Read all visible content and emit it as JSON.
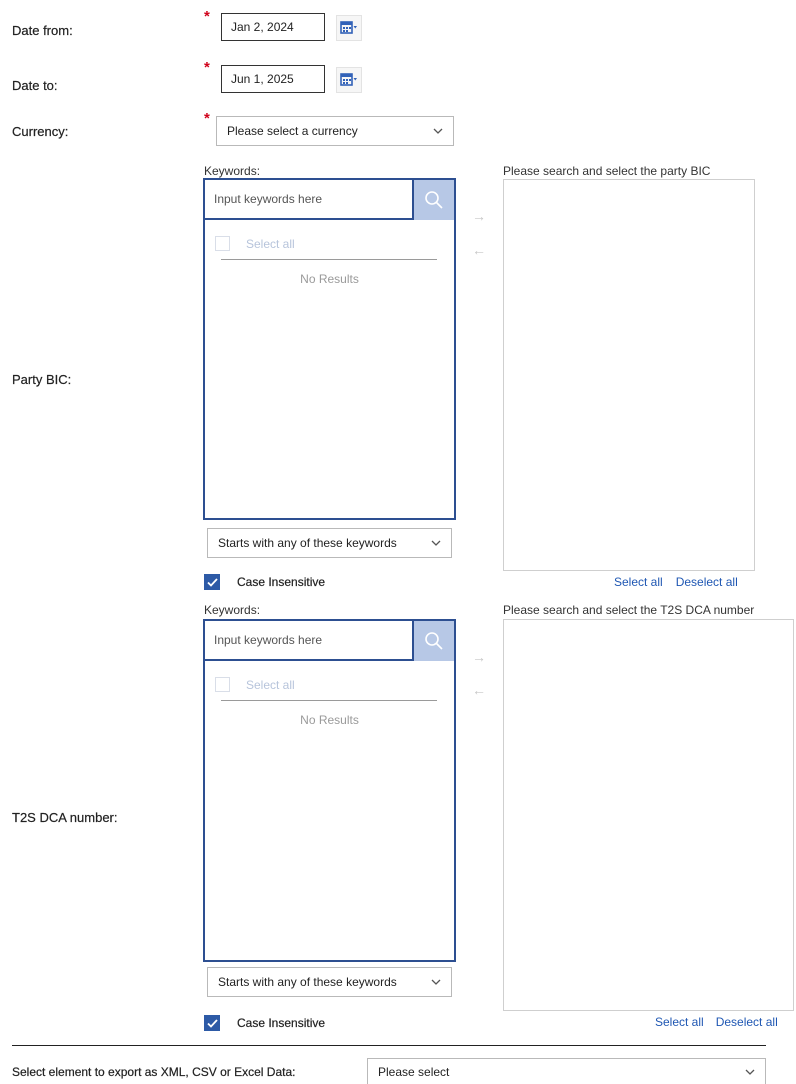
{
  "date_from": {
    "label": "Date from:",
    "value": "Jan 2, 2024"
  },
  "date_to": {
    "label": "Date to:",
    "value": "Jun 1, 2025"
  },
  "currency": {
    "label": "Currency:",
    "value": "Please select a currency"
  },
  "party_bic": {
    "label": "Party BIC:",
    "keywords_label": "Keywords:",
    "search_placeholder": "Input keywords here",
    "select_all_checkbox": "Select all",
    "no_results": "No Results",
    "match_mode": "Starts with any of these keywords",
    "case_insensitive": "Case Insensitive",
    "right_caption": "Please search and select the party BIC",
    "select_all_link": "Select all",
    "deselect_all_link": "Deselect all"
  },
  "t2s_dca": {
    "label": "T2S DCA number:",
    "keywords_label": "Keywords:",
    "search_placeholder": "Input keywords here",
    "select_all_checkbox": "Select all",
    "no_results": "No Results",
    "match_mode": "Starts with any of these keywords",
    "case_insensitive": "Case Insensitive",
    "right_caption": "Please search and select the T2S DCA number",
    "select_all_link": "Select all",
    "deselect_all_link": "Deselect all"
  },
  "export": {
    "label": "Select element to export as XML, CSV or Excel Data:",
    "value": "Please select"
  },
  "required_marker": "*",
  "colors": {
    "accent": "#2d4f91",
    "link": "#1f57b3",
    "required": "#d0021b",
    "search_button": "#b7c8e6"
  }
}
